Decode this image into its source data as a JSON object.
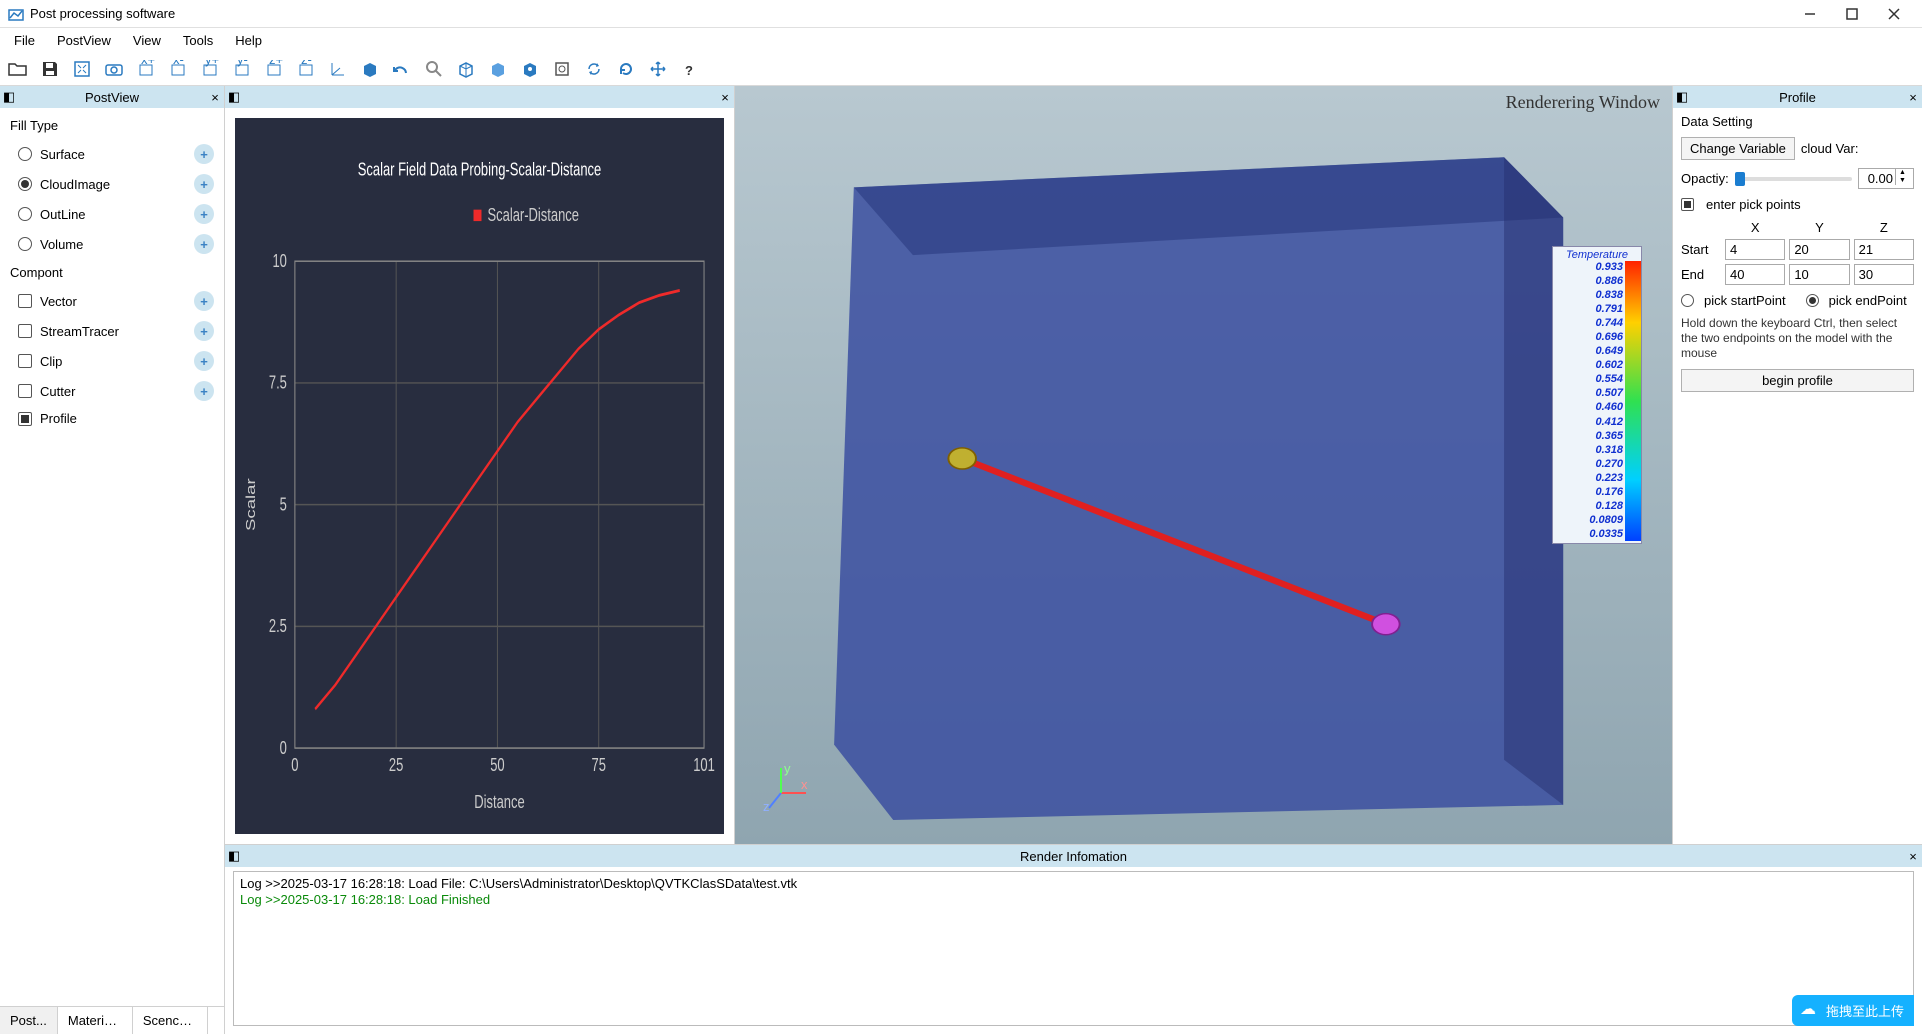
{
  "app": {
    "title": "Post processing software"
  },
  "menu": {
    "file": "File",
    "postview": "PostView",
    "view": "View",
    "tools": "Tools",
    "help": "Help"
  },
  "left": {
    "title": "PostView",
    "fill_type_label": "Fill Type",
    "fill_opts": {
      "surface": "Surface",
      "cloudimage": "CloudImage",
      "outline": "OutLine",
      "volume": "Volume"
    },
    "compont_label": "Compont",
    "compont_opts": {
      "vector": "Vector",
      "streamtracer": "StreamTracer",
      "clip": "Clip",
      "cutter": "Cutter",
      "profile": "Profile"
    },
    "tabs": {
      "post": "Post...",
      "material": "Material L...",
      "scence": "Scence..."
    }
  },
  "chart_data": {
    "type": "line",
    "title": "Scalar Field Data Probing-Scalar-Distance",
    "legend": "Scalar-Distance",
    "xlabel": "Distance",
    "ylabel": "Scalar",
    "xlim": [
      0,
      101
    ],
    "ylim": [
      0,
      10
    ],
    "xticks": [
      0,
      25,
      50,
      75,
      101
    ],
    "yticks": [
      0,
      2.5,
      5,
      7.5,
      10
    ],
    "series": [
      {
        "name": "Scalar-Distance",
        "color": "#ef2a2a",
        "x": [
          5,
          10,
          15,
          20,
          25,
          30,
          35,
          40,
          45,
          50,
          55,
          60,
          65,
          70,
          75,
          80,
          85,
          90,
          95
        ],
        "y": [
          0.8,
          1.3,
          1.9,
          2.5,
          3.1,
          3.7,
          4.3,
          4.9,
          5.5,
          6.1,
          6.7,
          7.2,
          7.7,
          8.2,
          8.6,
          8.9,
          9.15,
          9.3,
          9.4
        ]
      }
    ]
  },
  "render": {
    "title": "Renderering Window",
    "colorbar_title": "Temperature",
    "colorbar_values": [
      "0.933",
      "0.886",
      "0.838",
      "0.791",
      "0.744",
      "0.696",
      "0.649",
      "0.602",
      "0.554",
      "0.507",
      "0.460",
      "0.412",
      "0.365",
      "0.318",
      "0.270",
      "0.223",
      "0.176",
      "0.128",
      "0.0809",
      "0.0335"
    ]
  },
  "profile": {
    "title": "Profile",
    "data_setting": "Data Setting",
    "change_variable": "Change Variable",
    "cloud_var_label": "cloud Var:",
    "opacity_label": "Opactiy:",
    "opacity_value": "0.00",
    "enter_pick_label": "enter pick points",
    "col_x": "X",
    "col_y": "Y",
    "col_z": "Z",
    "start_label": "Start",
    "end_label": "End",
    "start": {
      "x": "4",
      "y": "20",
      "z": "21"
    },
    "end": {
      "x": "40",
      "y": "10",
      "z": "30"
    },
    "pick_start": "pick startPoint",
    "pick_end": "pick endPoint",
    "help": "Hold down the keyboard Ctrl, then select the two endpoints on the model with the mouse",
    "begin": "begin profile"
  },
  "renderinfo": {
    "title": "Render Infomation",
    "lines": [
      "Log >>2025-03-17 16:28:18: Load File: C:\\Users\\Administrator\\Desktop\\QVTKClasSData\\test.vtk",
      "Log >>2025-03-17 16:28:18: Load Finished"
    ]
  },
  "upload_pill": "拖拽至此上传"
}
